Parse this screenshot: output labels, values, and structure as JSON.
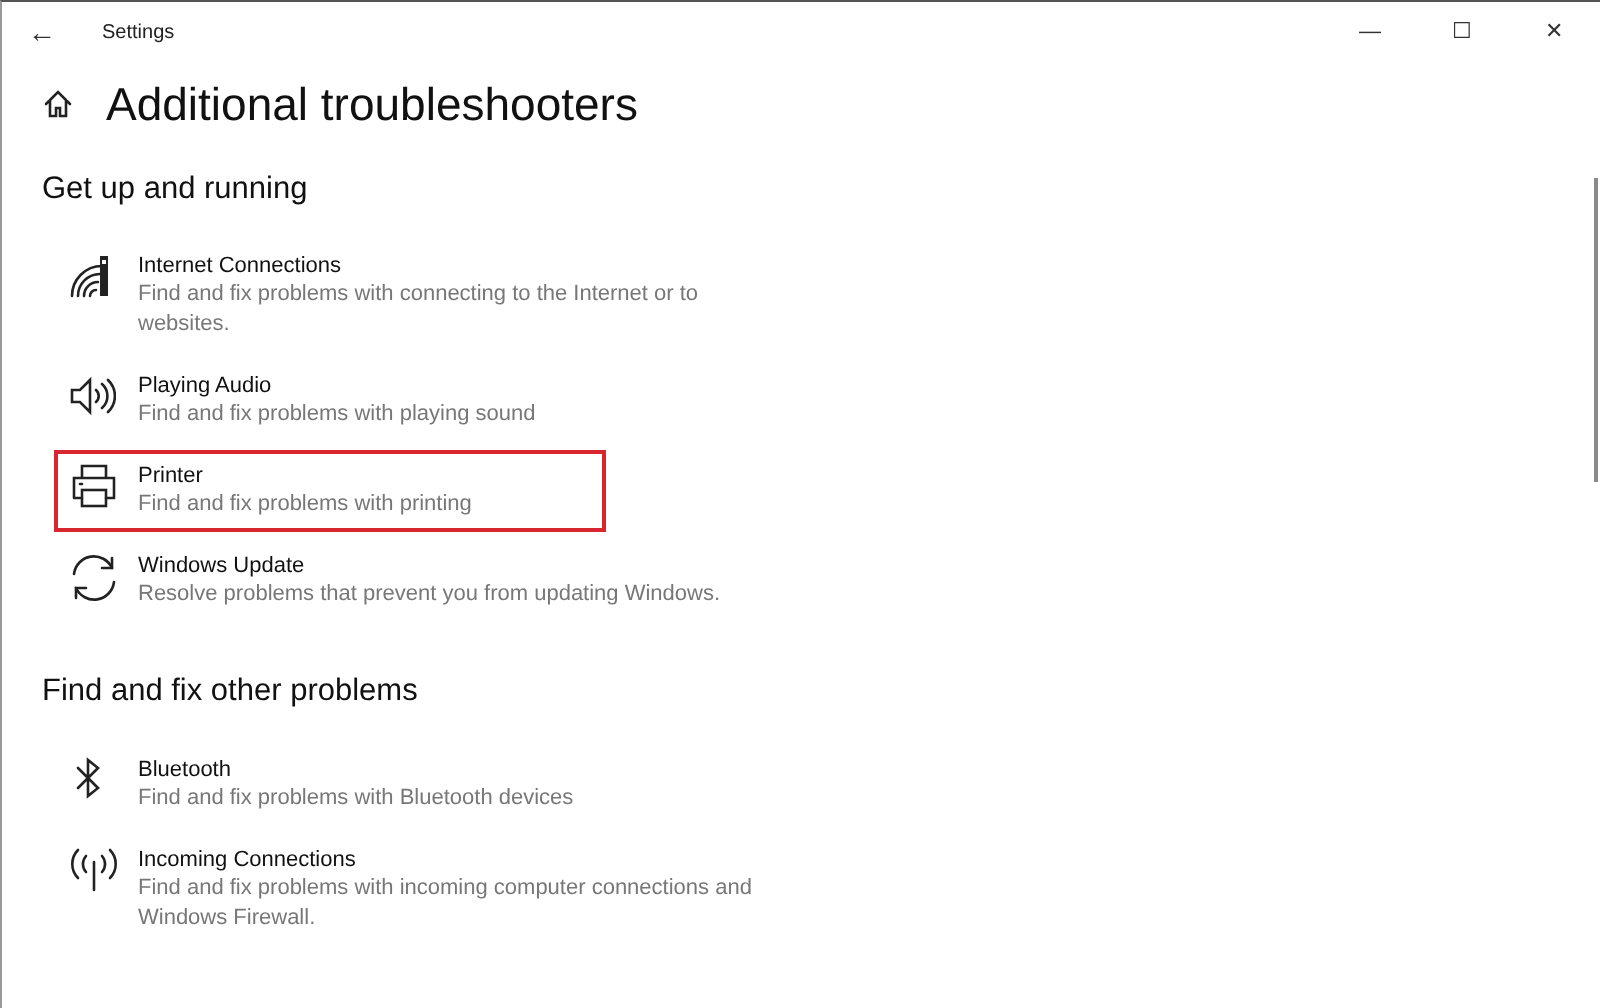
{
  "window": {
    "title": "Settings",
    "back": "←",
    "controls": [
      "—",
      "☐",
      "✕"
    ]
  },
  "page": {
    "title": "Additional troubleshooters"
  },
  "sections": [
    {
      "heading": "Get up and running",
      "items": [
        {
          "title": "Internet Connections",
          "description": "Find and fix problems with connecting to the Internet or to websites.",
          "highlighted": false
        },
        {
          "title": "Playing Audio",
          "description": "Find and fix problems with playing sound",
          "highlighted": false
        },
        {
          "title": "Printer",
          "description": "Find and fix problems with printing",
          "highlighted": true
        },
        {
          "title": "Windows Update",
          "description": "Resolve problems that prevent you from updating Windows.",
          "highlighted": false
        }
      ]
    },
    {
      "heading": "Find and fix other problems",
      "items": [
        {
          "title": "Bluetooth",
          "description": "Find and fix problems with Bluetooth devices",
          "highlighted": false
        },
        {
          "title": "Incoming Connections",
          "description": "Find and fix problems with incoming computer connections and Windows Firewall.",
          "highlighted": false
        }
      ]
    }
  ]
}
